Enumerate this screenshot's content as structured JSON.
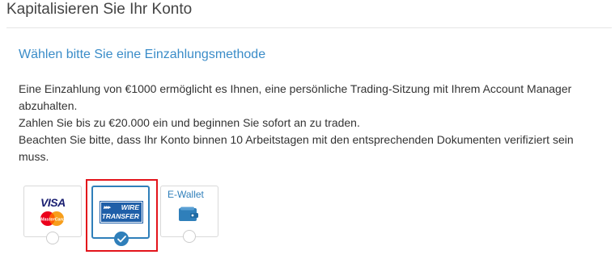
{
  "page": {
    "title": "Kapitalisieren Sie Ihr Konto"
  },
  "section": {
    "heading": "Wählen bitte Sie eine Einzahlungsmethode",
    "description_line1": "Eine Einzahlung von €1000 ermöglicht es Ihnen, eine persönliche Trading-Sitzung mit Ihrem Account Manager abzuhalten.",
    "description_line2": "Zahlen Sie bis zu €20.000 ein und beginnen Sie sofort an zu traden.",
    "description_line3": "Beachten Sie bitte, dass Ihr Konto binnen 10 Arbeitstagen mit den entsprechenden Dokumenten verifiziert sein muss."
  },
  "payment_methods": {
    "options": [
      {
        "id": "visa-mastercard",
        "logo_text": "VISA",
        "logo_subtext": "MasterCard",
        "icon": "visa-mastercard-icon",
        "selected": false
      },
      {
        "id": "wire-transfer",
        "logo_text_line1": "WIRE",
        "logo_text_line2": "TRANSFER",
        "logo_arrows": "▸▸▸",
        "icon": "wire-transfer-icon",
        "selected": true
      },
      {
        "id": "e-wallet",
        "label": "E-Wallet",
        "icon": "wallet-icon",
        "selected": false
      }
    ]
  },
  "colors": {
    "accent": "#2f7fba",
    "heading": "#3a8cc8",
    "highlight_border": "#e3141b",
    "visa_blue": "#1a1f71",
    "wire_blue": "#1f5fa8",
    "mc_red": "#eb001b",
    "mc_orange": "#f79e1b"
  }
}
